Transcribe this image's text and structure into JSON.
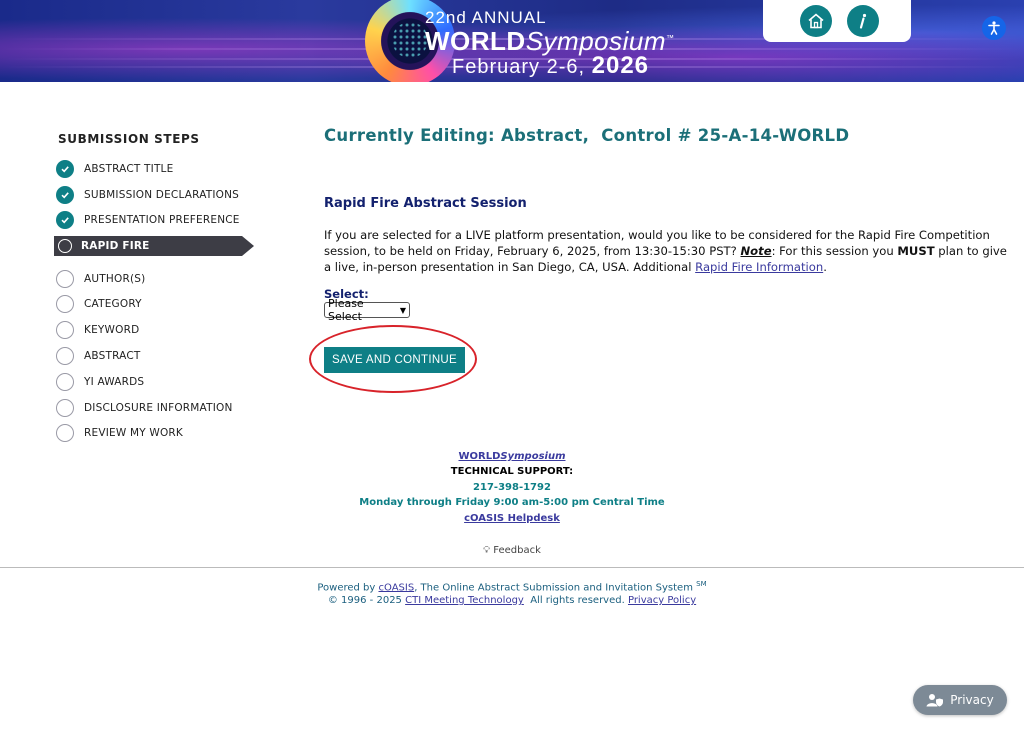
{
  "banner": {
    "annual": "22nd ANNUAL",
    "world_bold": "WORLD",
    "world_italic": "Symposium",
    "tm": "™",
    "dates": "February 2-6,",
    "year": "2026",
    "home_icon": "home-icon",
    "info_icon": "info-icon",
    "accessibility_icon": "accessibility-icon"
  },
  "sidebar": {
    "title": "SUBMISSION STEPS",
    "steps": [
      {
        "label": "ABSTRACT TITLE",
        "status": "done"
      },
      {
        "label": "SUBMISSION DECLARATIONS",
        "status": "done"
      },
      {
        "label": "PRESENTATION PREFERENCE",
        "status": "done"
      },
      {
        "label": "RAPID FIRE",
        "status": "active"
      },
      {
        "label": "AUTHOR(S)",
        "status": "todo"
      },
      {
        "label": "CATEGORY",
        "status": "todo"
      },
      {
        "label": "KEYWORD",
        "status": "todo"
      },
      {
        "label": "ABSTRACT",
        "status": "todo"
      },
      {
        "label": "YI AWARDS",
        "status": "todo"
      },
      {
        "label": "DISCLOSURE INFORMATION",
        "status": "todo"
      },
      {
        "label": "REVIEW MY WORK",
        "status": "todo"
      }
    ]
  },
  "main": {
    "title": "Currently Editing: Abstract,  Control # 25-A-14-WORLD",
    "section_title": "Rapid Fire Abstract Session",
    "desc_1": "If you are selected for a LIVE platform presentation, would you like to be considered for the Rapid Fire Competition session, to be held on Friday, February 6, 2025, from 13:30-15:30 PST? ",
    "desc_note": "Note",
    "desc_2": ": For this session you ",
    "desc_must": "MUST",
    "desc_3": " plan to give a live, in-person presentation in San Diego, CA, USA. Additional ",
    "desc_link": "Rapid Fire Information",
    "desc_4": ".",
    "select_label": "Select:",
    "select_value": "Please Select",
    "save_button": "SAVE AND CONTINUE"
  },
  "footer": {
    "world_bold": "WORLD",
    "world_italic": "Symposium",
    "tech_support": "TECHNICAL SUPPORT:",
    "phone": "217-398-1792",
    "hours": "Monday through Friday 9:00 am-5:00 pm Central Time",
    "helpdesk": "cOASIS Helpdesk",
    "feedback": "Feedback",
    "powered_prefix": "Powered by ",
    "powered_link": "cOASIS",
    "powered_suffix": ", The Online Abstract Submission and Invitation System ",
    "powered_sup": "SM",
    "copyright_prefix": "© 1996 - 2025 ",
    "copyright_link": "CTI Meeting Technology",
    "copyright_mid": "  All rights reserved. ",
    "privacy_link": "Privacy Policy",
    "privacy_button": "Privacy"
  },
  "colors": {
    "teal": "#0e7f86",
    "navy": "#13216e",
    "active_step": "#3d3d45",
    "highlight": "#d8232a"
  }
}
